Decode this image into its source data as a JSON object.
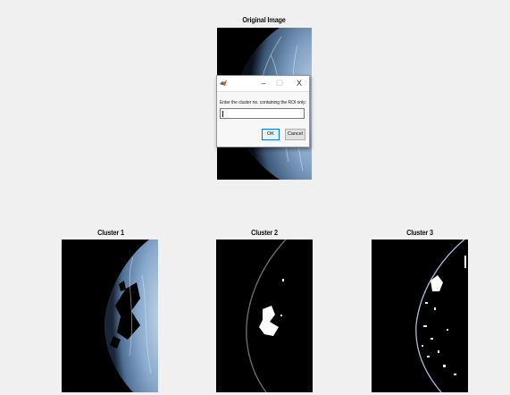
{
  "figure": {
    "original_title": "Original Image",
    "cluster_titles": [
      "Cluster 1",
      "Cluster 2",
      "Cluster 3"
    ]
  },
  "dialog": {
    "minimize_glyph": "–",
    "maximize_glyph": "☐",
    "close_glyph": "X",
    "prompt": "Enter the cluster no. containing the ROI only:",
    "input_value": "",
    "ok_label": "OK",
    "cancel_label": "Cancel",
    "icon": "matlab-icon"
  },
  "colors": {
    "figure_background": "#f0f0f0",
    "tissue": "#8fb0d2",
    "accent": "#0078d7"
  }
}
